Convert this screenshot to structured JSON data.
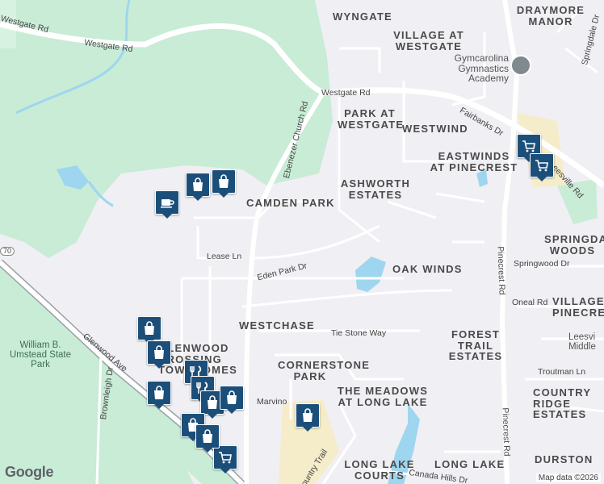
{
  "areas": [
    "WYNGATE",
    "DRAYMORE MANOR",
    "VILLAGE AT WESTGATE",
    "PARK AT WESTGATE",
    "WESTWIND",
    "EASTWINDS AT PINECREST",
    "ASHWORTH ESTATES",
    "CAMDEN PARK",
    "SPRINGDALE WOODS",
    "OAK WINDS",
    "WESTCHASE",
    "FOREST TRAIL ESTATES",
    "GLENWOOD CROSSING TOWNHOMES",
    "CORNERSTONE PARK",
    "THE MEADOWS AT LONG LAKE",
    "VILLAGE PINECREST",
    "COUNTRY RIDGE ESTATES",
    "DURSTON",
    "LONG LAKE COURTS",
    "LONG LAKE"
  ],
  "roads": [
    "Westgate Rd",
    "Westgate Rd",
    "Westgate Rd",
    "Ebenezer Church Rd",
    "Fairbanks Dr",
    "Leesville Rd",
    "Springdale Dr",
    "Lease Ln",
    "Eden Park Dr",
    "Springwood Dr",
    "Pinecrest Rd",
    "Pinecrest Rd",
    "Oneal Rd",
    "Tie Stone Way",
    "Glenwood Ave",
    "Brownleigh Dr",
    "Marvino",
    "Troutman Ln",
    "Country Trail",
    "Canada Hills Dr",
    "70"
  ],
  "parks": [
    "William B. Umstead State Park"
  ],
  "pois": [
    "Gymcarolina Gymnastics Academy",
    "Leesvi Middle"
  ],
  "attribution": {
    "logo": "Google",
    "copyright": "Map data ©2026"
  },
  "pin_icons": [
    "coffee-icon",
    "shopping-bag-icon",
    "shopping-bag-icon",
    "shopping-bag-icon",
    "shopping-bag-icon",
    "restaurant-icon",
    "restaurant-icon",
    "shopping-bag-icon",
    "shopping-bag-icon",
    "shopping-bag-icon",
    "shopping-bag-icon",
    "shopping-cart-icon",
    "shopping-bag-icon",
    "shopping-cart-icon",
    "shopping-bag-icon",
    "shopping-cart-icon"
  ],
  "colors": {
    "land": "#f0eff3",
    "park": "#c8ecd6",
    "water": "#9fd6ef",
    "road": "#ffffff",
    "pin": "#1b4f7a",
    "commercial": "#f5ecc9"
  }
}
